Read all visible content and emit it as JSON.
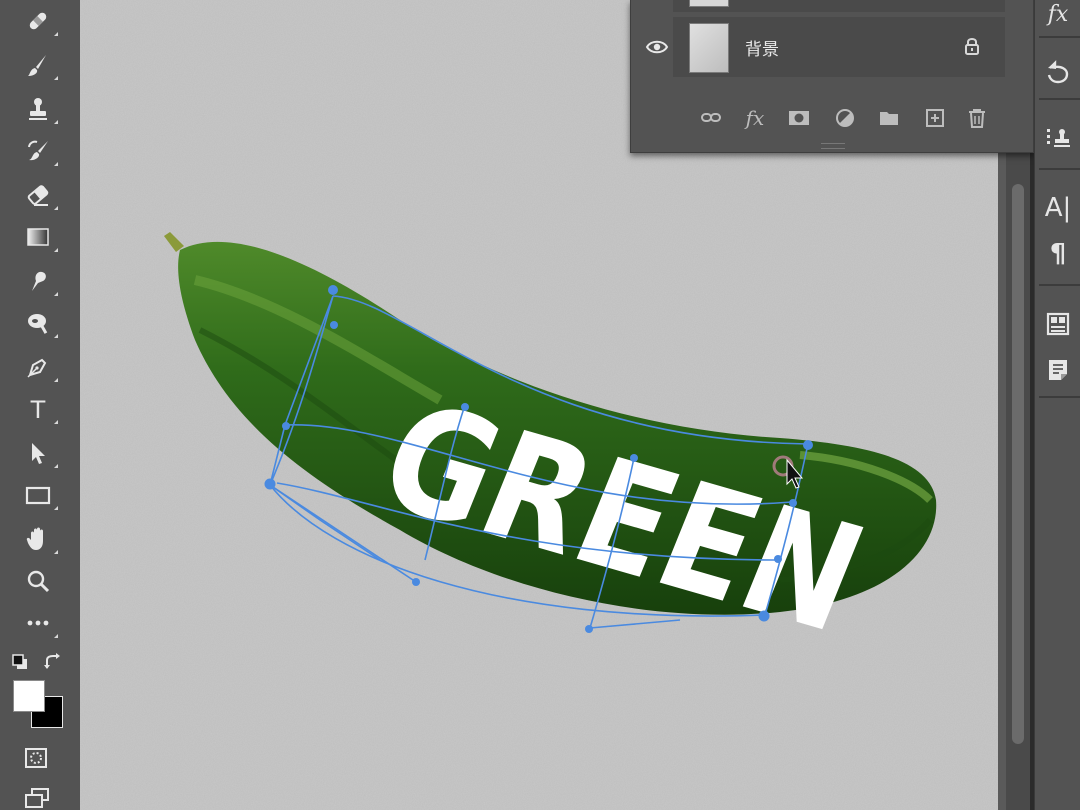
{
  "toolbar": {
    "tools": [
      {
        "name": "spot-healing-brush-tool",
        "icon": "bandage-icon"
      },
      {
        "name": "brush-tool",
        "icon": "brush-icon"
      },
      {
        "name": "clone-stamp-tool",
        "icon": "stamp-icon"
      },
      {
        "name": "history-brush-tool",
        "icon": "history-brush-icon"
      },
      {
        "name": "eraser-tool",
        "icon": "eraser-icon"
      },
      {
        "name": "gradient-tool",
        "icon": "gradient-icon"
      },
      {
        "name": "smudge-tool",
        "icon": "smudge-icon"
      },
      {
        "name": "dodge-tool",
        "icon": "dodge-icon"
      },
      {
        "name": "pen-tool",
        "icon": "pen-icon"
      },
      {
        "name": "type-tool",
        "icon": "type-icon"
      },
      {
        "name": "path-selection-tool",
        "icon": "arrow-icon"
      },
      {
        "name": "rectangle-tool",
        "icon": "rectangle-icon"
      },
      {
        "name": "hand-tool",
        "icon": "hand-icon"
      },
      {
        "name": "zoom-tool",
        "icon": "zoom-icon"
      },
      {
        "name": "edit-toolbar",
        "icon": "more-icon"
      }
    ],
    "foreground_color": "#ffffff",
    "background_color": "#000000",
    "type_glyph": "T"
  },
  "layers_panel": {
    "layer_name": "背景",
    "locked": true,
    "visible": true,
    "bottom_buttons": [
      "link-layers-icon",
      "fx-icon",
      "layer-mask-icon",
      "adjustment-layer-icon",
      "group-folder-icon",
      "new-layer-icon",
      "trash-icon"
    ],
    "fx_label": "fx"
  },
  "canvas": {
    "text": "GREEN",
    "background_color": "#c4c4c4",
    "warp_mesh_color": "#4a8ae0",
    "cucumber_color": "#2f6b1a"
  },
  "right_dock": {
    "fx_label": "fx",
    "char_label": "A|",
    "para_label": "¶"
  }
}
